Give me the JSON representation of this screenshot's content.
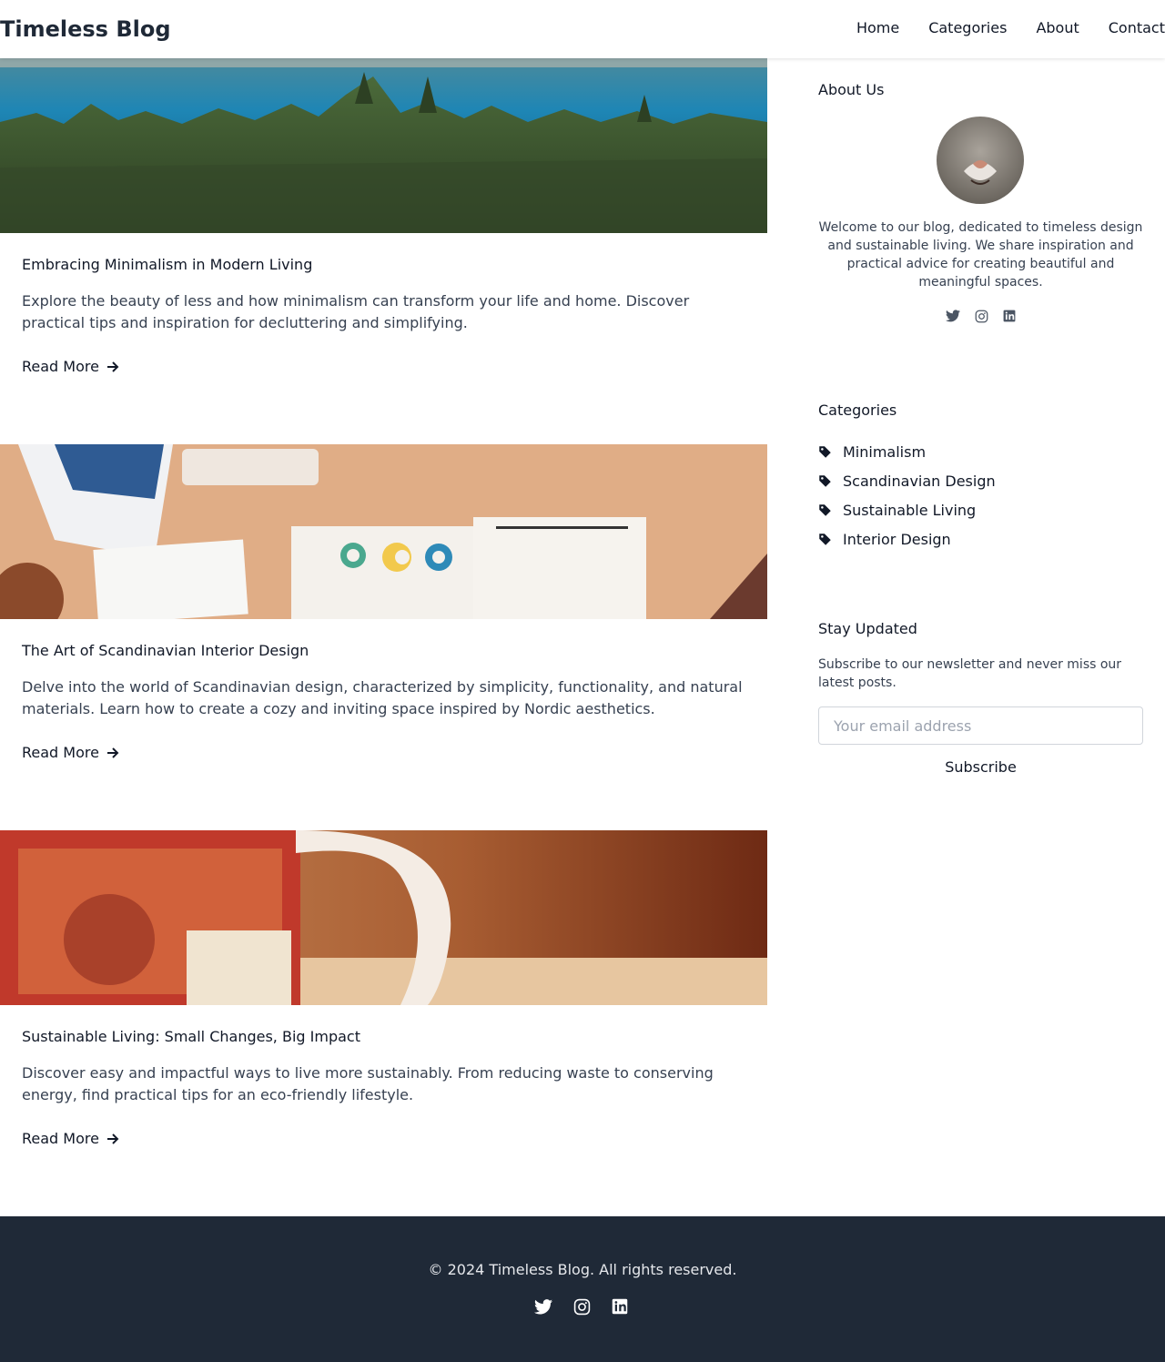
{
  "header": {
    "brand": "Timeless Blog",
    "nav": [
      "Home",
      "Categories",
      "About",
      "Contact"
    ]
  },
  "posts": [
    {
      "image": "forest-lake-photo",
      "title": "Embracing Minimalism in Modern Living",
      "excerpt": "Explore the beauty of less and how minimalism can transform your life and home. Discover practical tips and inspiration for decluttering and simplifying.",
      "read_more": "Read More"
    },
    {
      "image": "design-desk-photo",
      "title": "The Art of Scandinavian Interior Design",
      "excerpt": "Delve into the world of Scandinavian design, characterized by simplicity, functionality, and natural materials. Learn how to create a cozy and inviting space inspired by Nordic aesthetics.",
      "read_more": "Read More"
    },
    {
      "image": "mug-photo",
      "title": "Sustainable Living: Small Changes, Big Impact",
      "excerpt": "Discover easy and impactful ways to live more sustainably. From reducing waste to conserving energy, find practical tips for an eco-friendly lifestyle.",
      "read_more": "Read More"
    }
  ],
  "sidebar": {
    "about": {
      "heading": "About Us",
      "text": "Welcome to our blog, dedicated to timeless design and sustainable living. We share inspiration and practical advice for creating beautiful and meaningful spaces.",
      "social": [
        "twitter-icon",
        "instagram-icon",
        "linkedin-icon"
      ]
    },
    "categories": {
      "heading": "Categories",
      "items": [
        "Minimalism",
        "Scandinavian Design",
        "Sustainable Living",
        "Interior Design"
      ]
    },
    "newsletter": {
      "heading": "Stay Updated",
      "text": "Subscribe to our newsletter and never miss our latest posts.",
      "placeholder": "Your email address",
      "button": "Subscribe"
    }
  },
  "footer": {
    "copyright": "© 2024 Timeless Blog. All rights reserved.",
    "social": [
      "twitter-icon",
      "instagram-icon",
      "linkedin-icon"
    ]
  },
  "colors": {
    "footer_bg": "#1f2937",
    "text": "#111827",
    "muted_text": "#374151"
  }
}
